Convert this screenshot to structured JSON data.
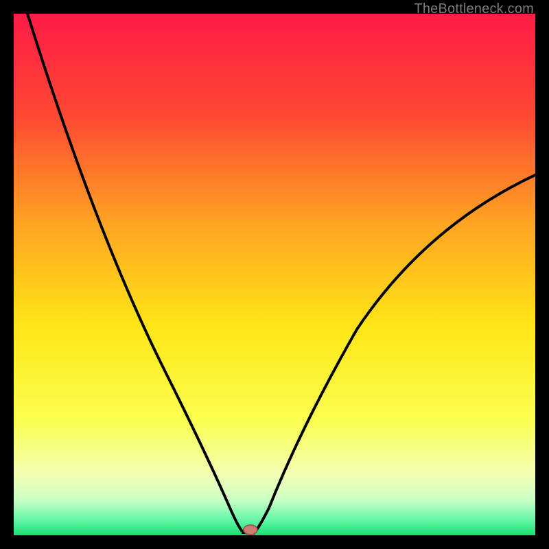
{
  "watermark": "TheBottleneck.com",
  "chart_data": {
    "type": "line",
    "title": "",
    "xlabel": "",
    "ylabel": "",
    "xlim": [
      0,
      100
    ],
    "ylim": [
      0,
      100
    ],
    "x": [
      0,
      5,
      10,
      15,
      20,
      25,
      30,
      35,
      40,
      42,
      44,
      46,
      48,
      50,
      55,
      60,
      65,
      70,
      75,
      80,
      85,
      90,
      95,
      100
    ],
    "series": [
      {
        "name": "bottleneck-curve",
        "values": [
          100,
          89,
          78,
          67,
          56,
          45,
          34,
          22,
          8,
          1,
          0,
          0,
          4,
          12,
          25,
          34,
          41,
          47,
          52,
          56,
          60,
          63,
          66,
          68
        ]
      }
    ],
    "minimum_x": 45,
    "background": {
      "stops": [
        {
          "pos": 0.0,
          "color": "#ff1b47"
        },
        {
          "pos": 0.2,
          "color": "#ff4a33"
        },
        {
          "pos": 0.4,
          "color": "#ffa322"
        },
        {
          "pos": 0.6,
          "color": "#ffe617"
        },
        {
          "pos": 0.78,
          "color": "#fbff50"
        },
        {
          "pos": 0.88,
          "color": "#f3ffb0"
        },
        {
          "pos": 0.93,
          "color": "#ceffc6"
        },
        {
          "pos": 0.97,
          "color": "#66f7a8"
        },
        {
          "pos": 1.0,
          "color": "#18e06f"
        }
      ]
    },
    "marker": {
      "x": 45,
      "color_fill": "#cf7b74",
      "color_stroke": "#9b4b44"
    }
  }
}
